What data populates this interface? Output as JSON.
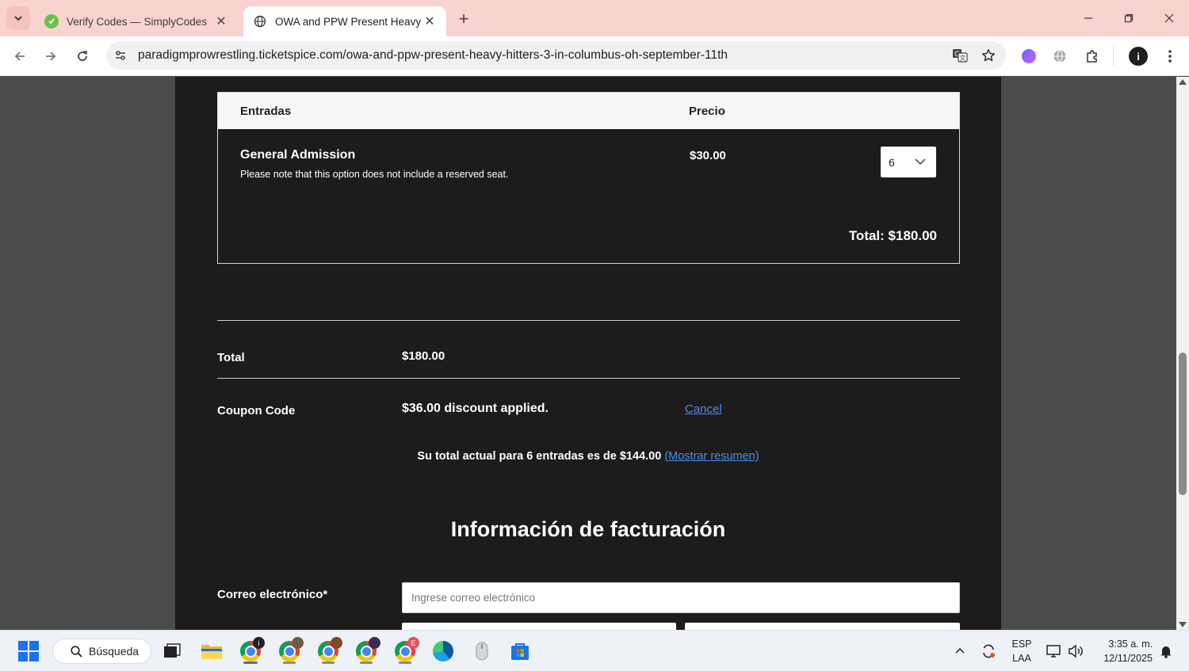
{
  "browser": {
    "tabs": [
      {
        "title": "Verify Codes — SimplyCodes",
        "active": false
      },
      {
        "title": "OWA and PPW Present Heavy Hitters",
        "active": true
      }
    ],
    "url": "paradigmprowrestling.ticketspice.com/owa-and-ppw-present-heavy-hitters-3-in-columbus-oh-september-11th"
  },
  "tickets": {
    "col_ticket": "Entradas",
    "col_price": "Precio",
    "item": {
      "name": "General Admission",
      "note": "Please note that this option does not include a reserved seat.",
      "price": "$30.00",
      "quantity": "6"
    },
    "total": "Total: $180.00"
  },
  "summary": {
    "total_label": "Total",
    "total_value": "$180.00",
    "coupon_label": "Coupon Code",
    "coupon_value": "$36.00 discount applied.",
    "cancel_label": "Cancel",
    "current_total_text": "Su total actual para 6 entradas es de",
    "current_total_value": "$144.00",
    "show_summary_link": "(Mostrar resumen)"
  },
  "billing": {
    "title": "Información de facturación",
    "email_label": "Correo electrónico*",
    "email_placeholder": "Ingrese correo electrónico",
    "email_value": ""
  },
  "taskbar": {
    "search_label": "Búsqueda",
    "language_1": "ESP",
    "language_2": "LAA",
    "time": "3:35 a. m.",
    "date": "12/11/2025"
  },
  "colors": {
    "tabbar_bg": "#f9d3d0",
    "page_bg": "#1d1b1c",
    "link": "#4a8ee8"
  }
}
